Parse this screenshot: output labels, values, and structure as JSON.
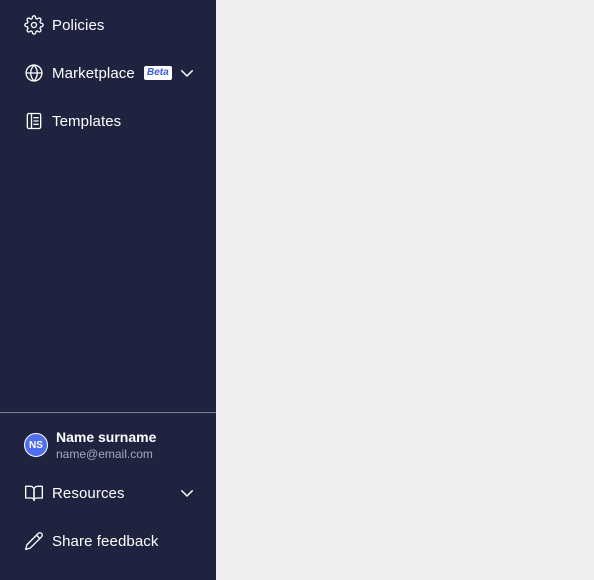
{
  "sidebar": {
    "items": [
      {
        "label": "Policies",
        "icon": "gear-icon"
      },
      {
        "label": "Marketplace",
        "icon": "globe-icon",
        "badge": "Beta",
        "expandable": true
      },
      {
        "label": "Templates",
        "icon": "templates-icon"
      }
    ],
    "user": {
      "initials": "NS",
      "name": "Name surname",
      "email": "name@email.com"
    },
    "footer": [
      {
        "label": "Resources",
        "icon": "book-icon",
        "expandable": true
      },
      {
        "label": "Share feedback",
        "icon": "pencil-icon"
      }
    ]
  },
  "colors": {
    "sidebar_bg": "#1f2340",
    "content_bg": "#efefef",
    "avatar_bg": "#4f6ef0",
    "badge_text": "#3b5bdb"
  }
}
